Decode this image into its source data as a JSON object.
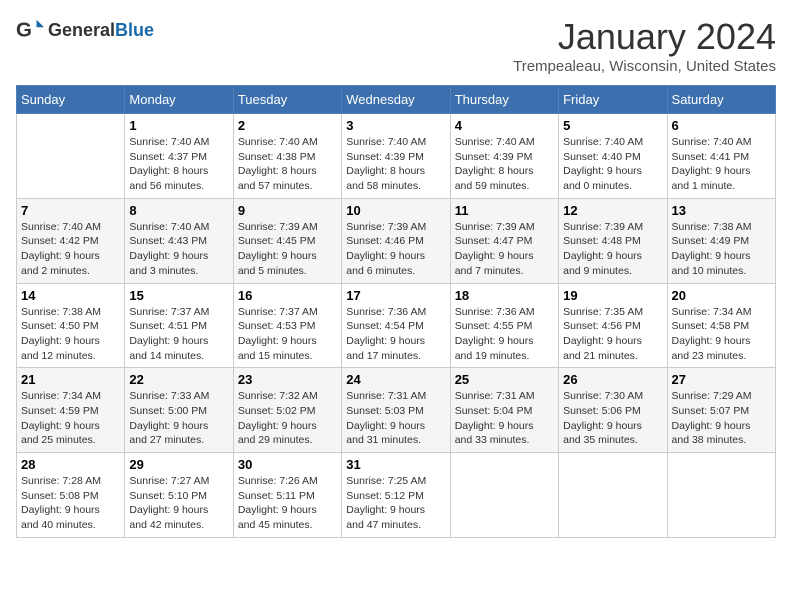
{
  "header": {
    "logo_general": "General",
    "logo_blue": "Blue",
    "month_title": "January 2024",
    "location": "Trempealeau, Wisconsin, United States"
  },
  "weekdays": [
    "Sunday",
    "Monday",
    "Tuesday",
    "Wednesday",
    "Thursday",
    "Friday",
    "Saturday"
  ],
  "weeks": [
    [
      {
        "day": "",
        "info": ""
      },
      {
        "day": "1",
        "info": "Sunrise: 7:40 AM\nSunset: 4:37 PM\nDaylight: 8 hours\nand 56 minutes."
      },
      {
        "day": "2",
        "info": "Sunrise: 7:40 AM\nSunset: 4:38 PM\nDaylight: 8 hours\nand 57 minutes."
      },
      {
        "day": "3",
        "info": "Sunrise: 7:40 AM\nSunset: 4:39 PM\nDaylight: 8 hours\nand 58 minutes."
      },
      {
        "day": "4",
        "info": "Sunrise: 7:40 AM\nSunset: 4:39 PM\nDaylight: 8 hours\nand 59 minutes."
      },
      {
        "day": "5",
        "info": "Sunrise: 7:40 AM\nSunset: 4:40 PM\nDaylight: 9 hours\nand 0 minutes."
      },
      {
        "day": "6",
        "info": "Sunrise: 7:40 AM\nSunset: 4:41 PM\nDaylight: 9 hours\nand 1 minute."
      }
    ],
    [
      {
        "day": "7",
        "info": "Sunrise: 7:40 AM\nSunset: 4:42 PM\nDaylight: 9 hours\nand 2 minutes."
      },
      {
        "day": "8",
        "info": "Sunrise: 7:40 AM\nSunset: 4:43 PM\nDaylight: 9 hours\nand 3 minutes."
      },
      {
        "day": "9",
        "info": "Sunrise: 7:39 AM\nSunset: 4:45 PM\nDaylight: 9 hours\nand 5 minutes."
      },
      {
        "day": "10",
        "info": "Sunrise: 7:39 AM\nSunset: 4:46 PM\nDaylight: 9 hours\nand 6 minutes."
      },
      {
        "day": "11",
        "info": "Sunrise: 7:39 AM\nSunset: 4:47 PM\nDaylight: 9 hours\nand 7 minutes."
      },
      {
        "day": "12",
        "info": "Sunrise: 7:39 AM\nSunset: 4:48 PM\nDaylight: 9 hours\nand 9 minutes."
      },
      {
        "day": "13",
        "info": "Sunrise: 7:38 AM\nSunset: 4:49 PM\nDaylight: 9 hours\nand 10 minutes."
      }
    ],
    [
      {
        "day": "14",
        "info": "Sunrise: 7:38 AM\nSunset: 4:50 PM\nDaylight: 9 hours\nand 12 minutes."
      },
      {
        "day": "15",
        "info": "Sunrise: 7:37 AM\nSunset: 4:51 PM\nDaylight: 9 hours\nand 14 minutes."
      },
      {
        "day": "16",
        "info": "Sunrise: 7:37 AM\nSunset: 4:53 PM\nDaylight: 9 hours\nand 15 minutes."
      },
      {
        "day": "17",
        "info": "Sunrise: 7:36 AM\nSunset: 4:54 PM\nDaylight: 9 hours\nand 17 minutes."
      },
      {
        "day": "18",
        "info": "Sunrise: 7:36 AM\nSunset: 4:55 PM\nDaylight: 9 hours\nand 19 minutes."
      },
      {
        "day": "19",
        "info": "Sunrise: 7:35 AM\nSunset: 4:56 PM\nDaylight: 9 hours\nand 21 minutes."
      },
      {
        "day": "20",
        "info": "Sunrise: 7:34 AM\nSunset: 4:58 PM\nDaylight: 9 hours\nand 23 minutes."
      }
    ],
    [
      {
        "day": "21",
        "info": "Sunrise: 7:34 AM\nSunset: 4:59 PM\nDaylight: 9 hours\nand 25 minutes."
      },
      {
        "day": "22",
        "info": "Sunrise: 7:33 AM\nSunset: 5:00 PM\nDaylight: 9 hours\nand 27 minutes."
      },
      {
        "day": "23",
        "info": "Sunrise: 7:32 AM\nSunset: 5:02 PM\nDaylight: 9 hours\nand 29 minutes."
      },
      {
        "day": "24",
        "info": "Sunrise: 7:31 AM\nSunset: 5:03 PM\nDaylight: 9 hours\nand 31 minutes."
      },
      {
        "day": "25",
        "info": "Sunrise: 7:31 AM\nSunset: 5:04 PM\nDaylight: 9 hours\nand 33 minutes."
      },
      {
        "day": "26",
        "info": "Sunrise: 7:30 AM\nSunset: 5:06 PM\nDaylight: 9 hours\nand 35 minutes."
      },
      {
        "day": "27",
        "info": "Sunrise: 7:29 AM\nSunset: 5:07 PM\nDaylight: 9 hours\nand 38 minutes."
      }
    ],
    [
      {
        "day": "28",
        "info": "Sunrise: 7:28 AM\nSunset: 5:08 PM\nDaylight: 9 hours\nand 40 minutes."
      },
      {
        "day": "29",
        "info": "Sunrise: 7:27 AM\nSunset: 5:10 PM\nDaylight: 9 hours\nand 42 minutes."
      },
      {
        "day": "30",
        "info": "Sunrise: 7:26 AM\nSunset: 5:11 PM\nDaylight: 9 hours\nand 45 minutes."
      },
      {
        "day": "31",
        "info": "Sunrise: 7:25 AM\nSunset: 5:12 PM\nDaylight: 9 hours\nand 47 minutes."
      },
      {
        "day": "",
        "info": ""
      },
      {
        "day": "",
        "info": ""
      },
      {
        "day": "",
        "info": ""
      }
    ]
  ]
}
